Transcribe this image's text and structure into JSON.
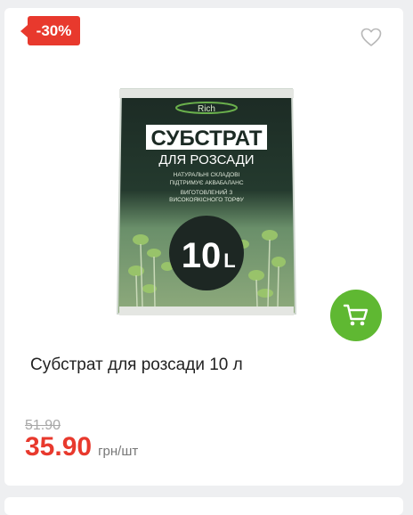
{
  "product": {
    "discount_badge": "-30%",
    "title": "Субстрат для розсади 10 л",
    "old_price": "51.90",
    "price": "35.90",
    "unit": "грн/шт",
    "image": {
      "brand": "Rich",
      "line1": "СУБСТРАТ",
      "line2": "ДЛЯ РОЗСАДИ",
      "features": [
        "НАТУРАЛЬНІ СКЛАДОВІ",
        "ПІДТРИМУЄ АКВАБАЛАНС",
        "ВИГОТОВЛЕНИЙ З",
        "ВИСОКОЯКІСНОГО ТОРФУ"
      ],
      "volume": "10",
      "volume_unit": "L"
    }
  },
  "colors": {
    "accent_red": "#e8392d",
    "cart_green": "#5fb832"
  },
  "icons": {
    "favorite": "heart-outline-icon",
    "cart": "shopping-cart-icon"
  }
}
